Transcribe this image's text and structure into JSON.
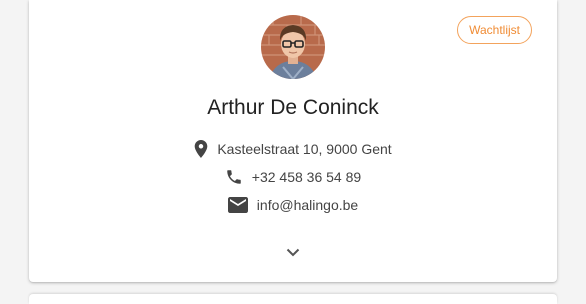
{
  "contact": {
    "status_badge": "Wachtlijst",
    "name": "Arthur De Coninck",
    "address": "Kasteelstraat 10, 9000 Gent",
    "phone": "+32 458 36 54 89",
    "email": "info@halingo.be"
  },
  "icons": {
    "address": "location-pin-icon",
    "phone": "phone-icon",
    "email": "mail-icon",
    "expand": "chevron-down-icon"
  },
  "colors": {
    "badge_accent": "#f08c35",
    "icon": "#444444",
    "text": "#222222"
  }
}
